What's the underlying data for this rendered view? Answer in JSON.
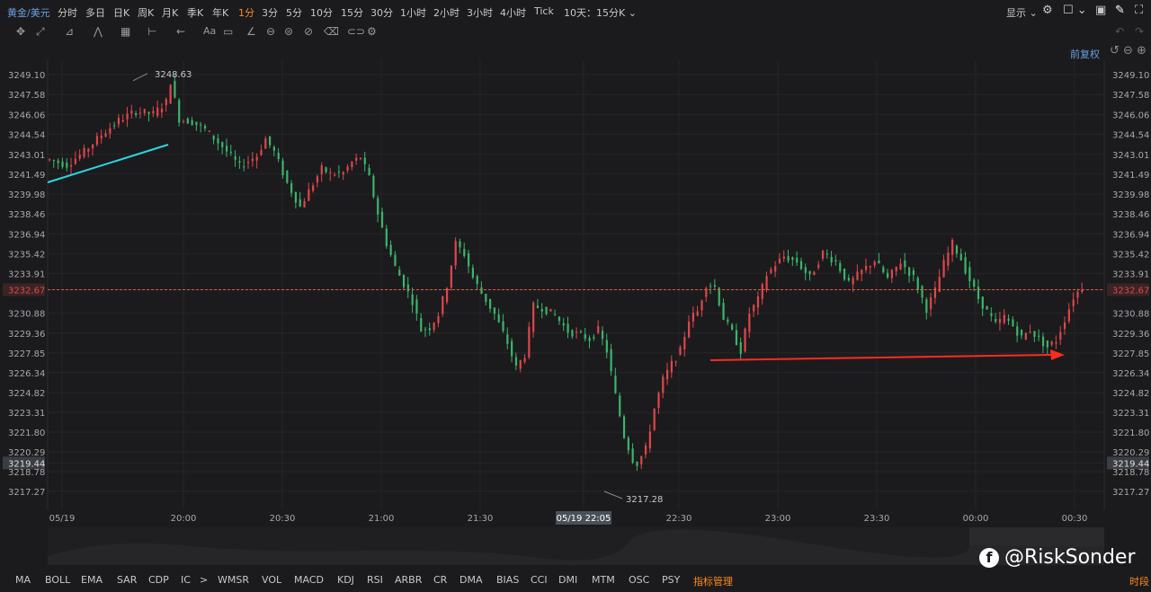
{
  "header": {
    "symbol": "黄金/美元",
    "timeframes": [
      "分时",
      "多日",
      "日K",
      "周K",
      "月K",
      "季K",
      "年K",
      "1分",
      "3分",
      "5分",
      "10分",
      "15分",
      "30分",
      "1小时",
      "2小时",
      "3小时",
      "4小时",
      "Tick"
    ],
    "active_timeframe": "1分",
    "range_select": "10天：15分K",
    "display_label": "显示",
    "adjust_label": "前复权"
  },
  "toolbar": {
    "text_tool_label": "Aa"
  },
  "indicators": {
    "items": [
      "MA",
      "BOLL",
      "EMA",
      "SAR",
      "CDP",
      "IC",
      ">",
      "WMSR",
      "VOL",
      "MACD",
      "KDJ",
      "RSI",
      "ARBR",
      "CR",
      "DMA",
      "BIAS",
      "CCI",
      "DMI",
      "MTM",
      "OSC",
      "PSY"
    ],
    "manage_label": "指标管理",
    "right_label": "时段"
  },
  "watermark": {
    "text": "@RiskSonder"
  },
  "colors": {
    "up": "#e0464b",
    "down": "#3bb56a",
    "trendline": "#2ad8e0",
    "arrow": "#ff2a22",
    "price_line": "#e05a3a",
    "accent": "#ff8a1e"
  },
  "chart_data": {
    "type": "candlestick",
    "y_ticks": [
      "3249.10",
      "3247.58",
      "3246.06",
      "3244.54",
      "3243.01",
      "3241.49",
      "3239.98",
      "3238.46",
      "3236.94",
      "3235.42",
      "3233.91",
      "3232.67",
      "3230.88",
      "3229.36",
      "3227.85",
      "3226.34",
      "3224.82",
      "3223.31",
      "3221.80",
      "3220.29",
      "3219.44",
      "3218.78",
      "3217.27"
    ],
    "ylim": [
      3216.0,
      3250.6
    ],
    "current_price": "3232.67",
    "low_marker": "3219.44",
    "x_ticks": [
      "05/19",
      "20:00",
      "20:30",
      "21:00",
      "21:30",
      "05/19 22:05",
      "22:30",
      "23:00",
      "23:30",
      "00:00",
      "00:30"
    ],
    "cursor_time": "05/19 22:05",
    "high_annotation": "3248.63",
    "low_annotation": "3217.28",
    "price_path": [
      [
        0,
        3242.6
      ],
      [
        4,
        3242.2
      ],
      [
        8,
        3243.2
      ],
      [
        12,
        3244.5
      ],
      [
        16,
        3245.6
      ],
      [
        20,
        3246.3
      ],
      [
        24,
        3246.1
      ],
      [
        27,
        3247.0
      ],
      [
        28,
        3248.6
      ],
      [
        30,
        3245.7
      ],
      [
        33,
        3245.5
      ],
      [
        36,
        3244.9
      ],
      [
        40,
        3243.6
      ],
      [
        44,
        3242.1
      ],
      [
        48,
        3242.9
      ],
      [
        50,
        3244.2
      ],
      [
        52,
        3243.2
      ],
      [
        55,
        3240.8
      ],
      [
        58,
        3239.0
      ],
      [
        60,
        3240.2
      ],
      [
        63,
        3241.9
      ],
      [
        65,
        3241.5
      ],
      [
        68,
        3241.6
      ],
      [
        70,
        3242.4
      ],
      [
        72,
        3242.8
      ],
      [
        74,
        3241.2
      ],
      [
        76,
        3238.5
      ],
      [
        78,
        3236.2
      ],
      [
        80,
        3234.4
      ],
      [
        82,
        3233.1
      ],
      [
        84,
        3231.8
      ],
      [
        86,
        3229.6
      ],
      [
        88,
        3229.8
      ],
      [
        90,
        3230.8
      ],
      [
        92,
        3233.0
      ],
      [
        94,
        3236.2
      ],
      [
        96,
        3235.4
      ],
      [
        98,
        3233.6
      ],
      [
        100,
        3232.4
      ],
      [
        103,
        3230.8
      ],
      [
        106,
        3228.6
      ],
      [
        108,
        3226.7
      ],
      [
        110,
        3227.7
      ],
      [
        112,
        3231.4
      ],
      [
        114,
        3231.3
      ],
      [
        117,
        3230.7
      ],
      [
        120,
        3229.5
      ],
      [
        123,
        3229.2
      ],
      [
        125,
        3228.9
      ],
      [
        127,
        3229.6
      ],
      [
        129,
        3228.0
      ],
      [
        131,
        3224.6
      ],
      [
        133,
        3221.5
      ],
      [
        135,
        3219.7
      ],
      [
        136,
        3219.4
      ],
      [
        138,
        3220.5
      ],
      [
        140,
        3223.6
      ],
      [
        142,
        3225.8
      ],
      [
        144,
        3227.0
      ],
      [
        146,
        3228.0
      ],
      [
        148,
        3230.4
      ],
      [
        150,
        3231.0
      ],
      [
        152,
        3233.1
      ],
      [
        154,
        3232.9
      ],
      [
        156,
        3230.5
      ],
      [
        158,
        3229.4
      ],
      [
        160,
        3228.0
      ],
      [
        162,
        3230.9
      ],
      [
        164,
        3231.9
      ],
      [
        166,
        3233.8
      ],
      [
        168,
        3234.6
      ],
      [
        170,
        3235.2
      ],
      [
        173,
        3234.8
      ],
      [
        176,
        3233.6
      ],
      [
        179,
        3235.5
      ],
      [
        182,
        3234.8
      ],
      [
        185,
        3233.1
      ],
      [
        188,
        3234.1
      ],
      [
        191,
        3234.9
      ],
      [
        194,
        3233.5
      ],
      [
        197,
        3234.8
      ],
      [
        200,
        3233.6
      ],
      [
        203,
        3231.2
      ],
      [
        205,
        3232.6
      ],
      [
        207,
        3234.7
      ],
      [
        209,
        3236.2
      ],
      [
        211,
        3235.0
      ],
      [
        213,
        3233.4
      ],
      [
        215,
        3232.0
      ],
      [
        217,
        3231.0
      ],
      [
        219,
        3230.0
      ],
      [
        221,
        3230.6
      ],
      [
        223,
        3229.9
      ],
      [
        225,
        3229.0
      ],
      [
        227,
        3229.6
      ],
      [
        229,
        3228.9
      ],
      [
        231,
        3228.3
      ],
      [
        233,
        3228.8
      ],
      [
        235,
        3230.4
      ],
      [
        237,
        3232.1
      ],
      [
        239,
        3232.9
      ]
    ]
  }
}
